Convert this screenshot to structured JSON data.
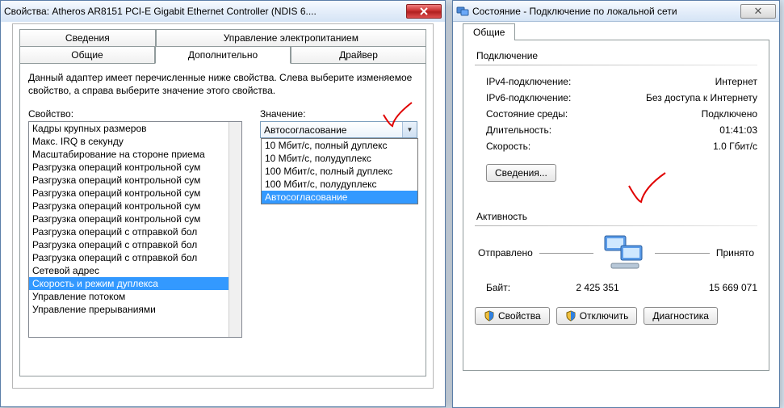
{
  "left": {
    "title": "Свойства: Atheros AR8151 PCI-E Gigabit Ethernet Controller (NDIS 6....",
    "tabs_top": [
      "Сведения",
      "Управление электропитанием"
    ],
    "tabs_bottom": [
      "Общие",
      "Дополнительно",
      "Драйвер"
    ],
    "active_tab_index": 1,
    "description": "Данный адаптер имеет перечисленные ниже свойства. Слева выберите изменяемое свойство, а справа выберите значение этого свойства.",
    "property_label": "Свойство:",
    "value_label": "Значение:",
    "properties": [
      "Кадры крупных размеров",
      "Макс. IRQ в секунду",
      "Масштабирование на стороне приема",
      "Разгрузка операций контрольной сум",
      "Разгрузка операций контрольной сум",
      "Разгрузка операций контрольной сум",
      "Разгрузка операций контрольной сум",
      "Разгрузка операций контрольной сум",
      "Разгрузка операций с отправкой бол",
      "Разгрузка операций с отправкой бол",
      "Разгрузка операций с отправкой бол",
      "Сетевой адрес",
      "Скорость и режим дуплекса",
      "Управление потоком",
      "Управление прерываниями"
    ],
    "selected_property_index": 12,
    "value_selected": "Автосогласование",
    "value_options": [
      "10 Мбит/c, полный дуплекс",
      "10 Мбит/c, полудуплекс",
      "100 Мбит/c, полный дуплекс",
      "100 Мбит/c, полудуплекс",
      "Автосогласование"
    ],
    "value_highlight_index": 4
  },
  "right": {
    "title": "Состояние - Подключение по локальной сети",
    "tab": "Общие",
    "group_conn": "Подключение",
    "rows_conn": [
      {
        "k": "IPv4-подключение:",
        "v": "Интернет"
      },
      {
        "k": "IPv6-подключение:",
        "v": "Без доступа к Интернету"
      },
      {
        "k": "Состояние среды:",
        "v": "Подключено"
      },
      {
        "k": "Длительность:",
        "v": "01:41:03"
      },
      {
        "k": "Скорость:",
        "v": "1.0 Гбит/с"
      }
    ],
    "btn_details": "Сведения...",
    "group_act": "Активность",
    "sent": "Отправлено",
    "recv": "Принято",
    "bytes_label": "Байт:",
    "bytes_sent": "2 425 351",
    "bytes_recv": "15 669 071",
    "btn_props": "Свойства",
    "btn_disable": "Отключить",
    "btn_diag": "Диагностика"
  }
}
